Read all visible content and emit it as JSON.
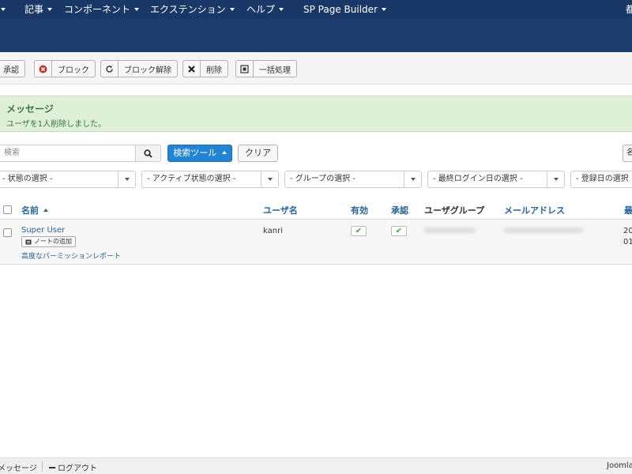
{
  "topbar": {
    "menu": [
      {
        "label": ""
      },
      {
        "label": "記事"
      },
      {
        "label": "コンポーネント"
      },
      {
        "label": "エクステンション"
      },
      {
        "label": "ヘルプ"
      },
      {
        "label": "SP Page Builder"
      }
    ],
    "right_text": "都"
  },
  "toolbar": {
    "approve": "承認",
    "block": "ブロック",
    "unblock": "ブロック解除",
    "delete": "削除",
    "batch": "一括処理"
  },
  "message": {
    "title": "メッセージ",
    "text": "ユーザを1人削除しました。"
  },
  "search": {
    "placeholder": "検索",
    "tools_label": "検索ツール",
    "clear_label": "クリア",
    "right_cut": "名"
  },
  "filters": [
    "- 状態の選択 -",
    "- アクティブ状態の選択 -",
    "- グループの選択 -",
    "- 最終ログイン日の選択 -",
    "- 登録日の選択"
  ],
  "table": {
    "headers": {
      "name": "名前",
      "username": "ユーザ名",
      "enabled": "有効",
      "activated": "承認",
      "groups": "ユーザグループ",
      "email": "メールアドレス",
      "last": "最"
    },
    "rows": [
      {
        "name": "Super User",
        "note_button": "ノートの追加",
        "permission_link": "高度なパーミッションレポート",
        "username": "kanri",
        "date_line1": "20",
        "date_line2": "01"
      }
    ]
  },
  "footer": {
    "messages": "メッセージ",
    "logout": "ログアウト",
    "right": "Joomla"
  },
  "colors": {
    "topbar": "#1a3867",
    "header": "#1c3d6e",
    "primary_button": "#2384d3",
    "success_bg": "#dff0d8",
    "success_text": "#3c763d",
    "link": "#2a6496"
  }
}
